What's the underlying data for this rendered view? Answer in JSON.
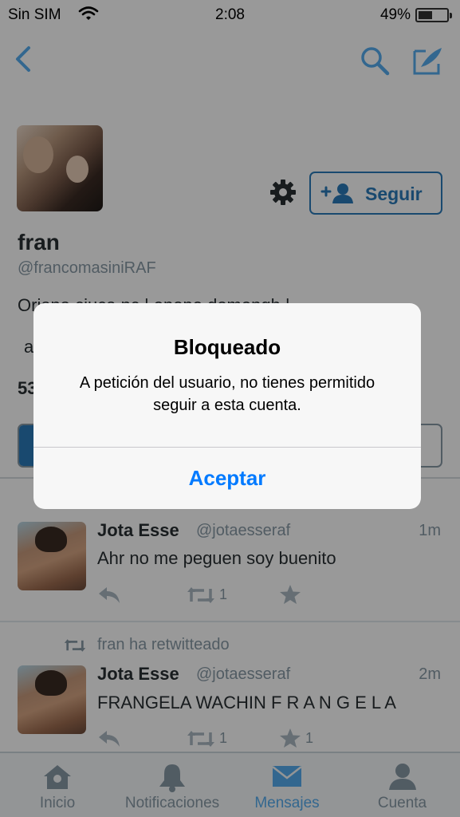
{
  "status_bar": {
    "carrier": "Sin SIM",
    "time": "2:08",
    "battery_percent": "49%",
    "battery_level": 0.49
  },
  "profile": {
    "name": "fran",
    "handle": "@francomasiniRAF",
    "bio_line1": "Oriana ciuca nc | enone.domengh |",
    "bio_line2": "a",
    "count_partial": "53",
    "follow_label": "Seguir"
  },
  "tweets": [
    {
      "author": "Jota Esse",
      "handle": "@jotaesseraf",
      "time": "1m",
      "text": "Ahr no me peguen soy buenito",
      "retweets": "1",
      "favorites": ""
    },
    {
      "retweet_note": "fran ha retwitteado",
      "author": "Jota Esse",
      "handle": "@jotaesseraf",
      "time": "2m",
      "text": "FRANGELA WACHIN F R A N G E L A",
      "retweets": "1",
      "favorites": "1"
    }
  ],
  "tab_bar": {
    "items": [
      {
        "label": "Inicio",
        "icon": "home-icon"
      },
      {
        "label": "Notificaciones",
        "icon": "bell-icon"
      },
      {
        "label": "Mensajes",
        "icon": "envelope-icon"
      },
      {
        "label": "Cuenta",
        "icon": "person-icon"
      }
    ],
    "active": "Mensajes"
  },
  "alert": {
    "title": "Bloqueado",
    "message": "A petición del usuario, no tienes permitido seguir a esta cuenta.",
    "button": "Aceptar"
  },
  "colors": {
    "accent": "#2b7bb9",
    "active_tab": "#55acee",
    "alert_button": "#007aff"
  }
}
